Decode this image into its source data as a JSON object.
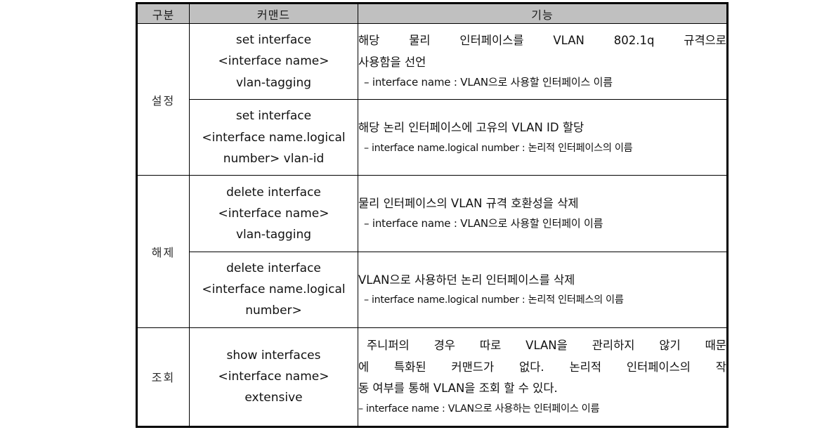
{
  "table": {
    "headers": {
      "division": "구분",
      "command": "커맨드",
      "function": "기능"
    },
    "colors": {
      "header_background": "#c0c0c0",
      "border": "#000000",
      "text": "#111111",
      "page_background": "#ffffff"
    },
    "groups": [
      {
        "division": "설정",
        "rows": [
          {
            "command_lines": [
              "set interface",
              "<interface name>",
              "vlan-tagging"
            ],
            "function_lines": [
              "해당 물리 인터페이스를 VLAN 802.1q 규격으로",
              "사용함을 선언",
              "– interface name : VLAN으로 사용할 인터페이스 이름"
            ]
          },
          {
            "command_lines": [
              "set interface",
              "<interface name.logical",
              "number> vlan-id"
            ],
            "function_lines": [
              "해당 논리 인터페이스에 고유의 VLAN ID 할당",
              "– interface name.logical number : 논리적 인터페이스의 이름"
            ]
          }
        ]
      },
      {
        "division": "해제",
        "rows": [
          {
            "command_lines": [
              "delete interface",
              "<interface name>",
              "vlan-tagging"
            ],
            "function_lines": [
              "물리 인터페이스의 VLAN 규격 호환성을 삭제",
              "– interface name : VLAN으로 사용할 인터페이 이름"
            ]
          },
          {
            "command_lines": [
              "delete interface",
              "<interface name.logical",
              "number>"
            ],
            "function_lines": [
              "VLAN으로 사용하던 논리 인터페이스를 삭제",
              "– interface name.logical number : 논리적 인터페스의 이름"
            ]
          }
        ]
      },
      {
        "division": "조회",
        "rows": [
          {
            "command_lines": [
              "show interfaces",
              "<interface name>",
              "extensive"
            ],
            "function_lines": [
              "주니퍼의 경우 따로 VLAN을 관리하지 않기 때문",
              "에 특화된 커맨드가 없다. 논리적 인터페이스의 작",
              "동 여부를 통해 VLAN을 조회 할 수 있다.",
              "– interface name : VLAN으로 사용하는 인터페이스 이름"
            ]
          }
        ]
      }
    ]
  }
}
